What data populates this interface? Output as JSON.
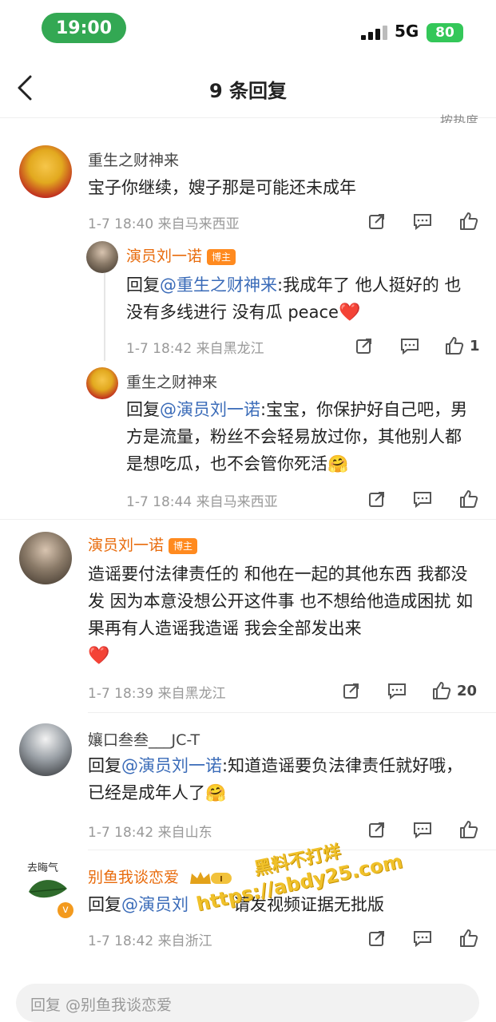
{
  "status": {
    "time": "19:00",
    "network": "5G",
    "battery": "80"
  },
  "nav": {
    "title": "9 条回复",
    "sort_label": "按热度"
  },
  "comments": [
    {
      "name": "重生之财神来",
      "text": "宝子你继续，嫂子那是可能还未成年",
      "meta": "1-7 18:40 来自马来西亚",
      "like_count": ""
    },
    {
      "name": "演员刘一诺",
      "badge": "博主",
      "reply_prefix": "回复",
      "mention": "@重生之财神来",
      "text": ":我成年了 他人挺好的 也没有多线进行 没有瓜 peace",
      "emoji": "❤️",
      "meta": "1-7 18:42 来自黑龙江",
      "like_count": "1"
    },
    {
      "name": "重生之财神来",
      "reply_prefix": "回复",
      "mention": "@演员刘一诺",
      "text": ":宝宝，你保护好自己吧，男方是流量，粉丝不会轻易放过你，其他别人都是想吃瓜，也不会管你死活",
      "emoji": "🤗",
      "meta": "1-7 18:44 来自马来西亚",
      "like_count": ""
    },
    {
      "name": "演员刘一诺",
      "badge": "博主",
      "text": "造谣要付法律责任的 和他在一起的其他东西 我都没发 因为本意没想公开这件事 也不想给他造成困扰 如果再有人造谣我造谣 我会全部发出来",
      "emoji": "❤️",
      "meta": "1-7 18:39 来自黑龙江",
      "like_count": "20"
    },
    {
      "name": "孃口叁叁___JC-T",
      "reply_prefix": "回复",
      "mention": "@演员刘一诺",
      "text": ":知道造谣要负法律责任就好哦，已经是成年人了",
      "emoji": "🤗",
      "meta": "1-7 18:42 来自山东",
      "like_count": ""
    },
    {
      "name": "别鱼我谈恋爱",
      "avatar_text": "去晦气",
      "reply_prefix": "回复",
      "mention": "@演员刘",
      "text": "请发视频证据无批版",
      "meta": "1-7 18:42 来自浙江",
      "like_count": ""
    }
  ],
  "watermark": {
    "line1": "黑料不打烊",
    "line2": "https://abdy25.com"
  },
  "reply_bar": {
    "placeholder": "回复 @别鱼我谈恋爱"
  },
  "colors": {
    "blogger_name": "#e86b0c",
    "mention": "#3a6bb8",
    "time_pill": "#33a853",
    "battery": "#34c759"
  }
}
